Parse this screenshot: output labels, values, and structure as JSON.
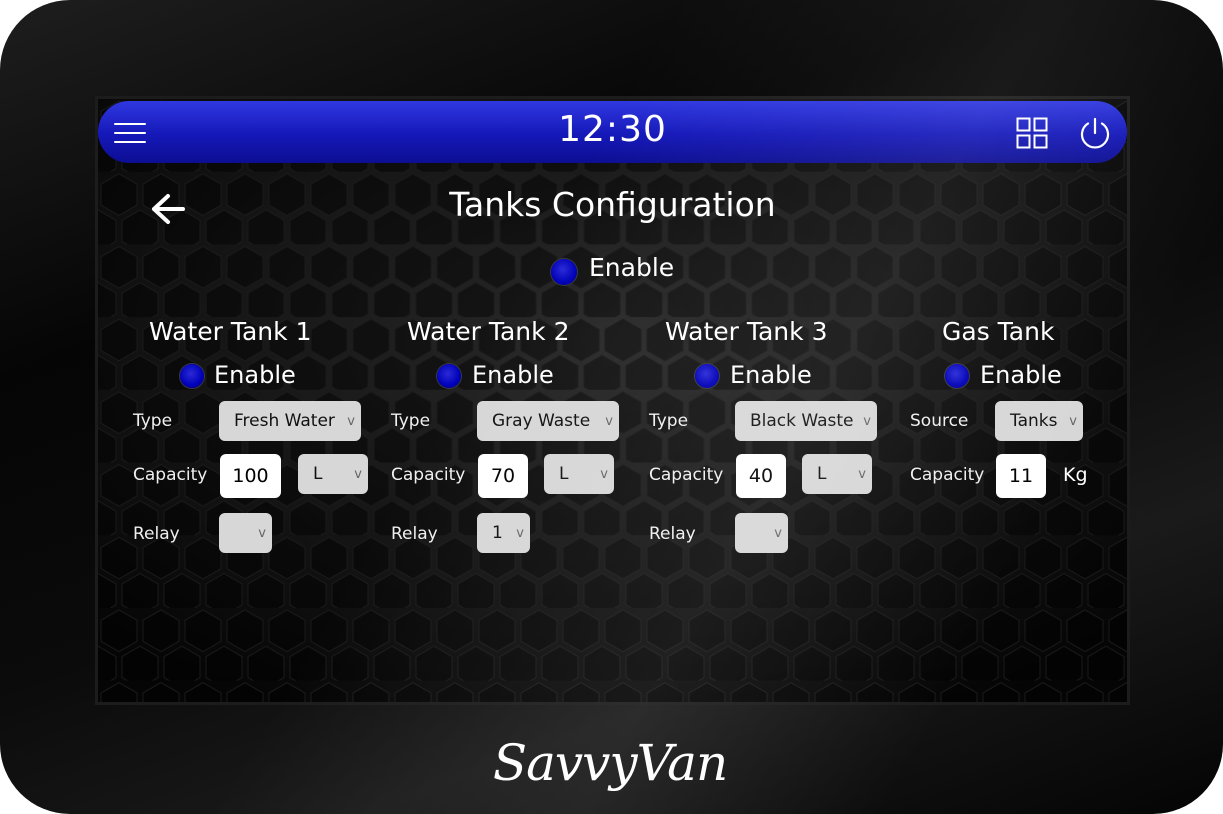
{
  "brand": {
    "logo_text": "SavvyVan"
  },
  "topbar": {
    "time": "12:30",
    "icons": {
      "menu": "hamburger-menu-icon",
      "apps": "grid-icon",
      "power": "power-icon"
    },
    "colors": {
      "bar_top": "#2f38e0",
      "bar_bottom": "#0c0e92"
    }
  },
  "page": {
    "title": "Tanks Configuration",
    "back_icon": "arrow-left-icon"
  },
  "global_enable": {
    "label": "Enable",
    "selected": true
  },
  "tanks": [
    {
      "title": "Water Tank 1",
      "enable_label": "Enable",
      "type_label": "Type",
      "type_value": "Fresh Water",
      "capacity_label": "Capacity",
      "capacity_value": "100",
      "unit_value": "L",
      "relay_label": "Relay",
      "relay_value": ""
    },
    {
      "title": "Water Tank 2",
      "enable_label": "Enable",
      "type_label": "Type",
      "type_value": "Gray Waste",
      "capacity_label": "Capacity",
      "capacity_value": "70",
      "unit_value": "L",
      "relay_label": "Relay",
      "relay_value": "1"
    },
    {
      "title": "Water Tank 3",
      "enable_label": "Enable",
      "type_label": "Type",
      "type_value": "Black Waste",
      "capacity_label": "Capacity",
      "capacity_value": "40",
      "unit_value": "L",
      "relay_label": "Relay",
      "relay_value": ""
    }
  ],
  "gas_tank": {
    "title": "Gas Tank",
    "enable_label": "Enable",
    "source_label": "Source",
    "source_value": "Tanks",
    "capacity_label": "Capacity",
    "capacity_value": "11",
    "unit": "Kg"
  },
  "dropdown_chevron": "v",
  "colors": {
    "radio": "#0000b8",
    "select_bg": "#d7d7d7",
    "input_bg": "#ffffff"
  }
}
